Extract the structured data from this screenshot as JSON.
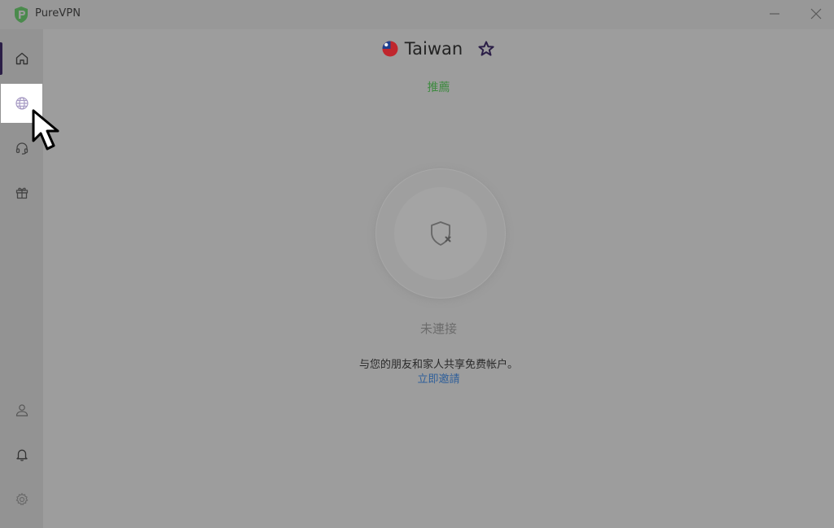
{
  "app": {
    "title": "PureVPN"
  },
  "sidebar": {
    "items": [
      {
        "name": "home",
        "icon": "home-icon"
      },
      {
        "name": "locations",
        "icon": "globe-icon"
      },
      {
        "name": "support",
        "icon": "headset-icon"
      },
      {
        "name": "gift",
        "icon": "gift-icon"
      },
      {
        "name": "account",
        "icon": "user-icon"
      },
      {
        "name": "notifications",
        "icon": "bell-icon"
      },
      {
        "name": "settings",
        "icon": "gear-icon"
      }
    ],
    "active": "home",
    "hovered": "locations"
  },
  "main": {
    "location": {
      "name": "Taiwan",
      "flag_icon": "taiwan-flag-icon",
      "favorite_icon": "star-icon"
    },
    "recommended_label": "推薦",
    "status": "未連接",
    "share_text": "与您的朋友和家人共享免费帐户。",
    "invite_link": "立即邀請"
  },
  "colors": {
    "accent_green": "#3d8a3f",
    "link_blue": "#2f5f9a",
    "active_indicator": "#2b1e47"
  }
}
